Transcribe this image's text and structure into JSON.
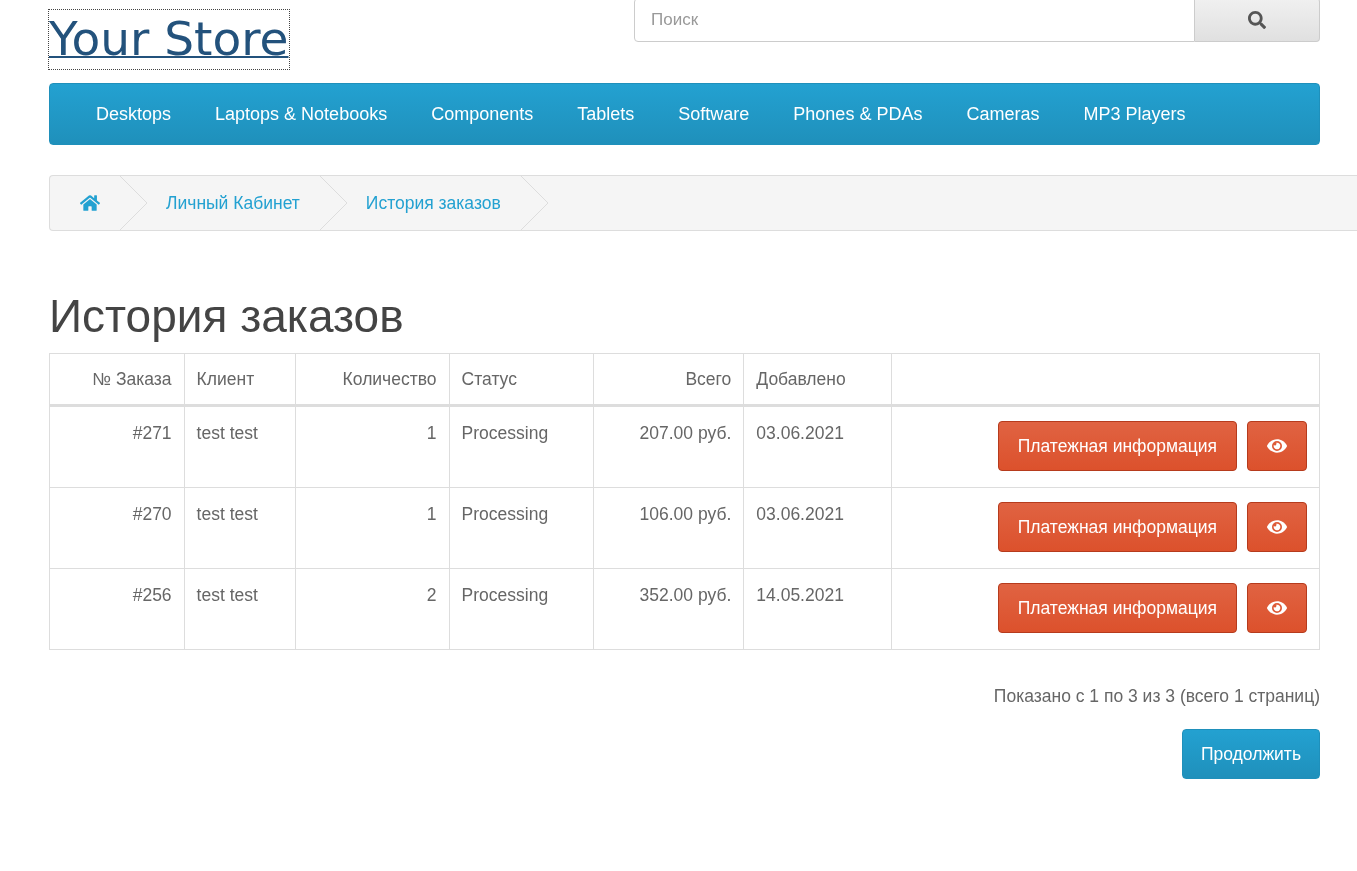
{
  "logo": "Your Store",
  "search": {
    "placeholder": "Поиск"
  },
  "menu": [
    "Desktops",
    "Laptops & Notebooks",
    "Components",
    "Tablets",
    "Software",
    "Phones & PDAs",
    "Cameras",
    "MP3 Players"
  ],
  "breadcrumb": [
    {
      "kind": "home"
    },
    {
      "kind": "link",
      "label": "Личный Кабинет"
    },
    {
      "kind": "link",
      "label": "История заказов"
    }
  ],
  "heading": "История заказов",
  "table": {
    "columns": [
      "№ Заказа",
      "Клиент",
      "Количество",
      "Статус",
      "Всего",
      "Добавлено"
    ],
    "rows": [
      {
        "cells": [
          "#271",
          "test test",
          "1",
          "Processing",
          "207.00 руб.",
          "03.06.2021"
        ],
        "action": "Платежная информация"
      },
      {
        "cells": [
          "#270",
          "test test",
          "1",
          "Processing",
          "106.00 руб.",
          "03.06.2021"
        ],
        "action": "Платежная информация"
      },
      {
        "cells": [
          "#256",
          "test test",
          "2",
          "Processing",
          "352.00 руб.",
          "14.05.2021"
        ],
        "action": "Платежная информация"
      }
    ]
  },
  "pagination": "Показано с 1 по 3 из 3 (всего 1 страниц)",
  "continue_button": "Продолжить"
}
